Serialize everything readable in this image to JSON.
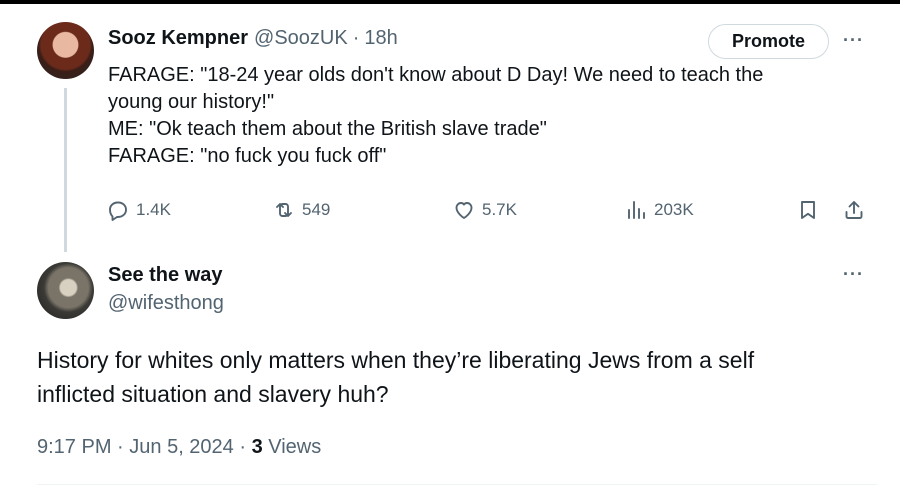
{
  "tweet1": {
    "display_name": "Sooz Kempner",
    "handle": "@SoozUK",
    "separator": "·",
    "time": "18h",
    "promote_label": "Promote",
    "more_label": "···",
    "body_lines": [
      "FARAGE: \"18-24 year olds don't know about D Day! We need to teach the",
      "young our history!\"",
      "ME: \"Ok teach them about the British slave trade\"",
      "FARAGE: \"no fuck you fuck off\""
    ],
    "actions": {
      "replies": "1.4K",
      "reposts": "549",
      "likes": "5.7K",
      "views": "203K"
    },
    "icons": [
      "reply-icon",
      "repost-icon",
      "like-icon",
      "views-icon",
      "bookmark-icon",
      "share-icon"
    ]
  },
  "tweet2": {
    "display_name": "See the way",
    "handle": "@wifesthong",
    "more_label": "···",
    "body_lines": [
      "History for whites only matters when they’re liberating Jews from a self",
      "inflicted situation and slavery huh?"
    ],
    "meta": {
      "time": "9:17 PM",
      "sep1": " · ",
      "date": "Jun 5, 2024",
      "sep2": " · ",
      "views_count": "3",
      "views_label": " Views"
    }
  },
  "colors": {
    "text": "#0f1419",
    "secondary": "#536471",
    "border": "#cfd9de"
  }
}
